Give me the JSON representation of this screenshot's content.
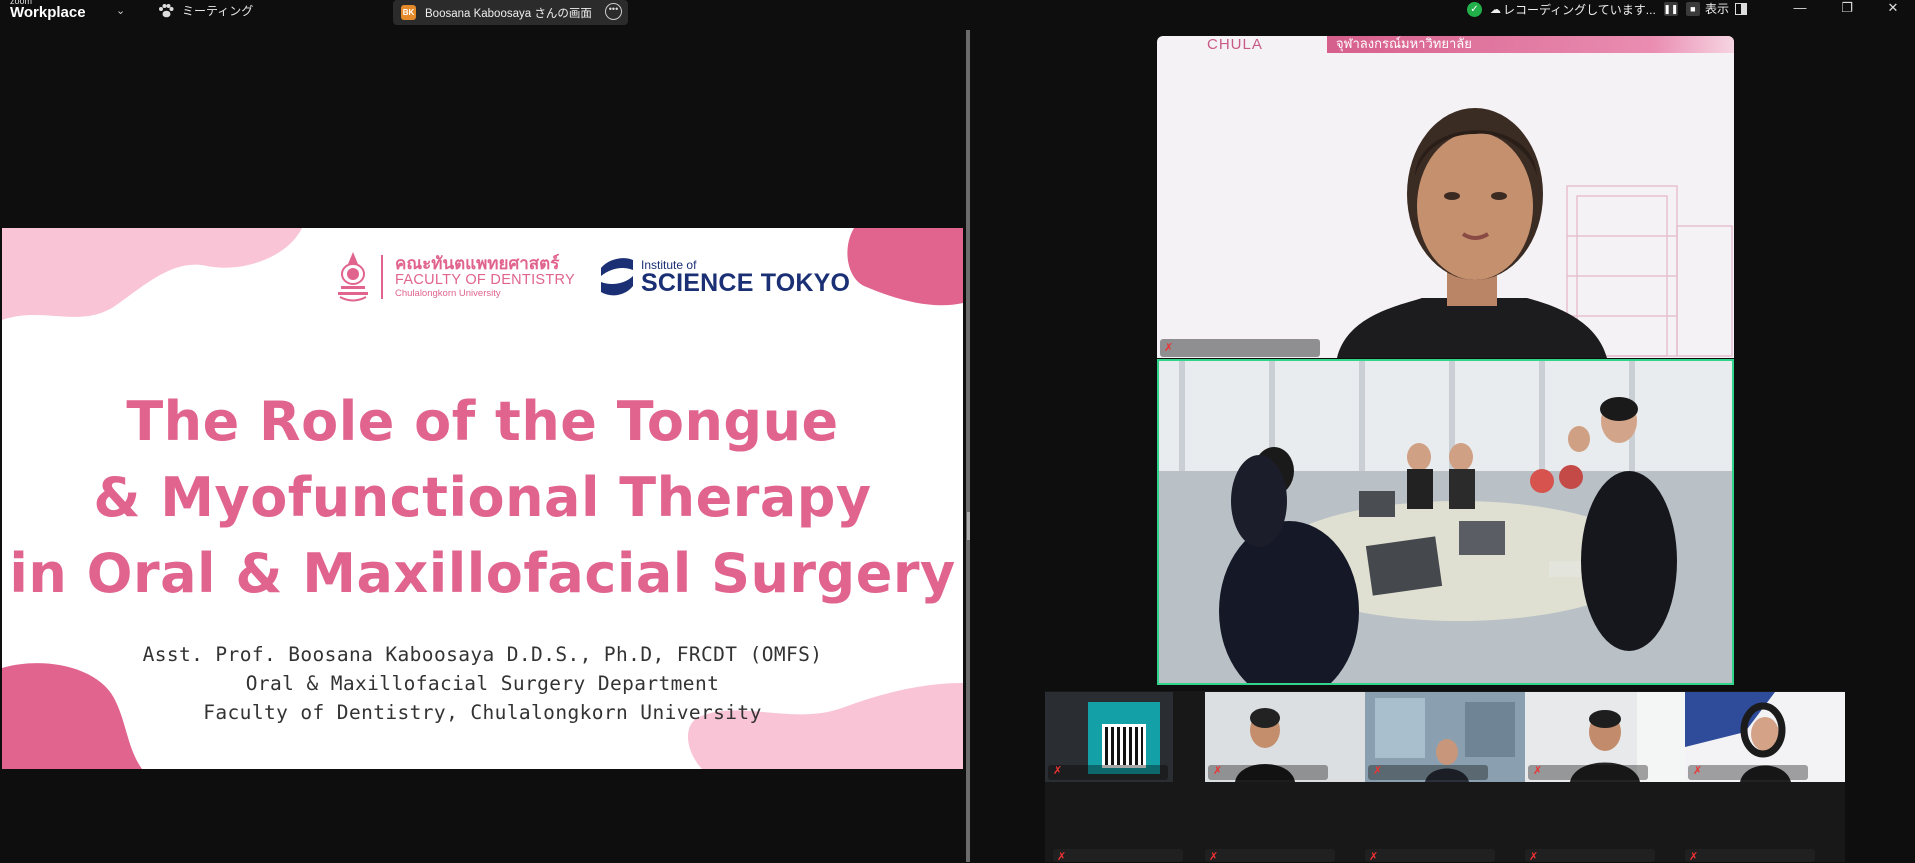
{
  "app": {
    "brand_small": "zoom",
    "brand_name": "Workplace",
    "meeting_label": "ミーティング",
    "share_label": "Boosana Kaboosaya さんの画面",
    "share_initials": "BK",
    "recording_label": "レコーディングしています...",
    "view_label": "表示",
    "icons": [
      "chevron-down-icon",
      "paw-meeting-icon",
      "more-icon",
      "shield-check-icon",
      "cloud-record-icon",
      "pause-icon",
      "stop-icon",
      "layout-icon",
      "minimize-icon",
      "restore-icon",
      "close-icon"
    ]
  },
  "slide": {
    "faculty_thai": "คณะทันตแพทยศาสตร์",
    "faculty_en": "FACULTY OF DENTISTRY",
    "faculty_uni": "Chulalongkorn University",
    "institute_small": "Institute of",
    "institute_big": "SCIENCE TOKYO",
    "title_line1": "The Role of the Tongue",
    "title_line2": "& Myofunctional Therapy",
    "title_line3": "in Oral & Maxillofacial Surgery",
    "presenter": "Asst. Prof. Boosana Kaboosaya D.D.S., Ph.D, FRCDT (OMFS)",
    "department": "Oral & Maxillofacial Surgery Department",
    "faculty_line": "Faculty of Dentistry, Chulalongkorn University",
    "colors": {
      "accent_pink": "#e0648d",
      "light_pink": "#f9c5d6",
      "navy": "#1a2f74"
    }
  },
  "videos": {
    "speaker_banner": "จุฬาลงกรณ์มหาวิทยาลัย",
    "speaker_logo": "CHULA",
    "active_border_color": "#30d48a"
  }
}
